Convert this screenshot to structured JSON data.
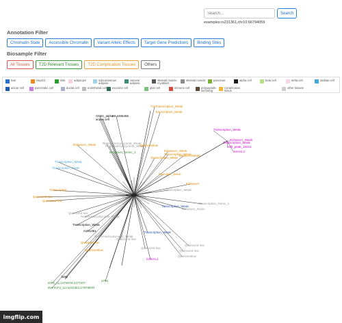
{
  "search": {
    "placeholder": "Search...",
    "button_label": "Search",
    "example": "examples:rs231361,chr10:66794059"
  },
  "annotation_filter": {
    "label": "Annotation Filter",
    "buttons": [
      "Chromatin State",
      "Accessible Chromatin",
      "Variant Allelic Effects",
      "Target Gene Predictions",
      "Binding Sites"
    ]
  },
  "biosample_filter": {
    "label": "Biosample Filter",
    "buttons": [
      "All Tissues",
      "T2D Relevant Tissues",
      "T2D Complication Tissues",
      "Others"
    ]
  },
  "legend": [
    {
      "label": "liver",
      "color": "#2e6fc9"
    },
    {
      "label": "HepG2",
      "color": "#f1871f"
    },
    {
      "label": "islet",
      "color": "#2a9d2a"
    },
    {
      "label": "adipocyte",
      "color": "#f6cfe0"
    },
    {
      "label": "subcutaneous adipose",
      "color": "#9fd3e6"
    },
    {
      "label": "visceral adipose",
      "color": "#3f8b78"
    },
    {
      "label": "skeletal muscle myoblast",
      "color": "#555555"
    },
    {
      "label": "skeletal muscle",
      "color": "#8a8a8a"
    },
    {
      "label": "pancreas",
      "color": "#7cae3a"
    },
    {
      "label": "alpha cell",
      "color": "#1c1c1c"
    },
    {
      "label": "beta cell",
      "color": "#b9de8c"
    },
    {
      "label": "delta cell",
      "color": "#f3d7e7"
    },
    {
      "label": "stellate cell",
      "color": "#4aa8d8"
    },
    {
      "label": "acinar cell",
      "color": "#1f5db0"
    },
    {
      "label": "pancreatic cell",
      "color": "#c97de0"
    },
    {
      "label": "ductal cell",
      "color": "#aab4c8"
    },
    {
      "label": "endothelial cell",
      "color": "#bdbdbd"
    },
    {
      "label": "exocrine cell",
      "color": "#2f6a52"
    },
    {
      "label": "glial cell",
      "color": "#7cc47c"
    },
    {
      "label": "immune cell",
      "color": "#d84a3a"
    },
    {
      "label": "polypeptide-secreting",
      "color": "#5a4a36"
    },
    {
      "label": "complication tissue",
      "color": "#f3b43c"
    },
    {
      "label": "other tissues",
      "color": "#cfcfcf"
    }
  ],
  "graph": {
    "center_label": "rs231361",
    "nodes": [
      {
        "label": "TxpTranscription_Weak",
        "color": "#e08a00",
        "weight": "normal"
      },
      {
        "label": "transcription_Weak",
        "color": "#e08a00",
        "weight": "normal"
      },
      {
        "label": "CDE1_alpha",
        "color": "#000000",
        "weight": "normal"
      },
      {
        "label": "68-2455455",
        "color": "#000000",
        "weight": "normal"
      },
      {
        "label": "active cell",
        "color": "#000000",
        "weight": "normal"
      },
      {
        "label": "Enhancer_Weak",
        "color": "#e08a00",
        "weight": "normal"
      },
      {
        "label": "Repressed-polycomb_Weak",
        "color": "#999999",
        "weight": "normal"
      },
      {
        "label": "Repressed-polycomb_Weak",
        "color": "#999999",
        "weight": "normal"
      },
      {
        "label": "Quiescentlow",
        "color": "#e08a00",
        "weight": "normal"
      },
      {
        "label": "Enhancer_Genic_1",
        "color": "#2f8a2f",
        "weight": "normal"
      },
      {
        "label": "Transcription_Weak",
        "color": "#e08a00",
        "weight": "normal"
      },
      {
        "label": "Enhancer_Weak",
        "color": "#e08a00",
        "weight": "normal"
      },
      {
        "label": "EnhancerWeak",
        "color": "#e08a00",
        "weight": "normal"
      },
      {
        "label": "Transcription_Weak",
        "color": "#4aa8d8",
        "weight": "normal"
      },
      {
        "label": "Transcription_Weak",
        "color": "#4aa8d8",
        "weight": "normal"
      },
      {
        "label": "Transcription_Weak",
        "color": "#d400d4",
        "weight": "normal"
      },
      {
        "label": "Enhancer_Weak",
        "color": "#d400d4",
        "weight": "normal"
      },
      {
        "label": "Transcription_Weak",
        "color": "#d400d4",
        "weight": "normal"
      },
      {
        "label": "rsbl_peak_15231",
        "color": "#d400d4",
        "weight": "normal"
      },
      {
        "label": "MAX2.2",
        "color": "#d400d4",
        "weight": "normal"
      },
      {
        "label": "Transcription_Weak",
        "color": "#e08a00",
        "weight": "normal"
      },
      {
        "label": "Promoter_Genic",
        "color": "#e08a00",
        "weight": "normal"
      },
      {
        "label": "Transcription",
        "color": "#e08a00",
        "weight": "normal"
      },
      {
        "label": "Enhancer",
        "color": "#e08a00",
        "weight": "normal"
      },
      {
        "label": "Quiescent-low",
        "color": "#e08a00",
        "weight": "normal"
      },
      {
        "label": "Quiescent-low",
        "color": "#e08a00",
        "weight": "normal"
      },
      {
        "label": "Transcription_Weak",
        "color": "#999999",
        "weight": "normal"
      },
      {
        "label": "Transcription_Genic_1",
        "color": "#999999",
        "weight": "normal"
      },
      {
        "label": "Transcription_Weak",
        "color": "#1f4fb0",
        "weight": "normal"
      },
      {
        "label": "Enhancer_Genic",
        "color": "#999999",
        "weight": "normal"
      },
      {
        "label": "Quiescent-low",
        "color": "#999999",
        "weight": "normal"
      },
      {
        "label": "Repressed-polycomb_Weak",
        "color": "#999999",
        "weight": "normal"
      },
      {
        "label": "Transcription_Weak",
        "color": "#000000",
        "weight": "normal"
      },
      {
        "label": "rs231361",
        "color": "#000000",
        "weight": "normal"
      },
      {
        "label": "Transcription_Weak",
        "color": "#1f4fb0",
        "weight": "normal"
      },
      {
        "label": "Repressed-polycomb_Weak",
        "color": "#999999",
        "weight": "normal"
      },
      {
        "label": "Quiescent-low",
        "color": "#999999",
        "weight": "normal"
      },
      {
        "label": "Quiescentlow",
        "color": "#e08a00",
        "weight": "normal"
      },
      {
        "label": "Quiescentlow",
        "color": "#e08a00",
        "weight": "normal"
      },
      {
        "label": "Quiescent-low",
        "color": "#999999",
        "weight": "normal"
      },
      {
        "label": "Quiescent-low",
        "color": "#999999",
        "weight": "normal"
      },
      {
        "label": "Quiescentlow",
        "color": "#999999",
        "weight": "normal"
      },
      {
        "label": "Quiescent-low",
        "color": "#999999",
        "weight": "normal"
      },
      {
        "label": "CDKAL1",
        "color": "#d400d4",
        "weight": "normal"
      },
      {
        "label": "beta",
        "color": "#000000",
        "weight": "normal"
      },
      {
        "label": "IGF2_11:2170878-2177377",
        "color": "#2f8a2f",
        "weight": "normal"
      },
      {
        "label": "INS-IGF2_11:rs231361:1797897R",
        "color": "#2f8a2f",
        "weight": "normal"
      },
      {
        "label": "2750",
        "color": "#2f8a2f",
        "weight": "normal"
      }
    ]
  },
  "watermark": "imgflip.com"
}
